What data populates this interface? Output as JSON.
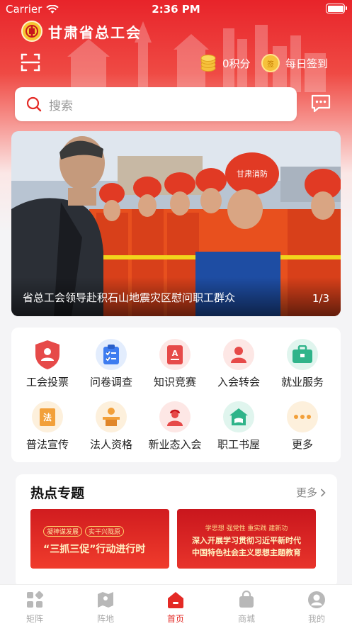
{
  "status_bar": {
    "carrier": "Carrier",
    "time": "2:36 PM"
  },
  "app": {
    "title": "甘肃省总工会"
  },
  "header": {
    "points_label": "0积分",
    "checkin_label": "每日签到",
    "checkin_seal": "签"
  },
  "search": {
    "placeholder": "搜索"
  },
  "banner": {
    "caption": "省总工会领导赴积石山地震灾区慰问职工群众",
    "pager": "1/3",
    "helmet_text": "甘肃消防"
  },
  "services": [
    {
      "label": "工会投票",
      "icon": "shield-user-icon"
    },
    {
      "label": "问卷调查",
      "icon": "clipboard-icon"
    },
    {
      "label": "知识竞赛",
      "icon": "quiz-icon"
    },
    {
      "label": "入会转会",
      "icon": "member-icon"
    },
    {
      "label": "就业服务",
      "icon": "briefcase-icon"
    },
    {
      "label": "普法宣传",
      "icon": "law-icon"
    },
    {
      "label": "法人资格",
      "icon": "podium-icon"
    },
    {
      "label": "新业态入会",
      "icon": "worker-icon"
    },
    {
      "label": "职工书屋",
      "icon": "book-house-icon"
    },
    {
      "label": "更多",
      "icon": "more-dots-icon"
    }
  ],
  "hot_topics": {
    "title": "热点专题",
    "more_label": "更多",
    "items": [
      {
        "tag_left": "凝神谋发展",
        "tag_right": "实干兴陇原",
        "headline": "“三抓三促”行动进行时"
      },
      {
        "tag": "学思想 强党性 重实践 建新功",
        "line1": "深入开展学习贯彻习近平新时代",
        "line2": "中国特色社会主义思想主题教育"
      }
    ]
  },
  "tabbar": [
    {
      "label": "矩阵",
      "icon": "grid-apps-icon"
    },
    {
      "label": "阵地",
      "icon": "map-icon"
    },
    {
      "label": "首页",
      "icon": "home-icon",
      "active": true
    },
    {
      "label": "商城",
      "icon": "shopping-bag-icon"
    },
    {
      "label": "我的",
      "icon": "user-icon"
    }
  ],
  "colors": {
    "brand_red": "#e42a25",
    "gold": "#f6c13b"
  }
}
